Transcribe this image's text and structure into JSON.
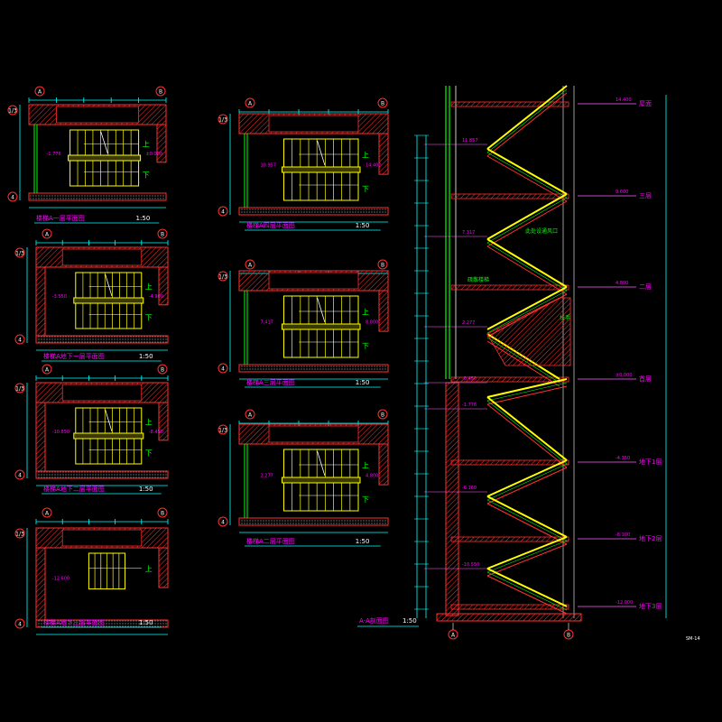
{
  "drawing": {
    "background": "#000000",
    "colors": {
      "wall": "#ff3030",
      "stair": "#ffff00",
      "dim": "#00ffff",
      "text": "#ff00ff",
      "green": "#00ff00",
      "white": "#ffffff",
      "level": "#ff60ff"
    },
    "sheet_code": "SM-14"
  },
  "plans": [
    {
      "id": "p1",
      "title": "楼梯A一层平面图",
      "scale": "1:50",
      "grid_left": "A",
      "grid_right": "B",
      "axis_top": "1/3",
      "axis_bottom": "4",
      "level_1": "-1.776",
      "level_2": "±0.000",
      "up": "上",
      "down": "下"
    },
    {
      "id": "p2",
      "title": "楼梯A地下一层平面图",
      "scale": "1:50",
      "grid_left": "A",
      "grid_right": "B",
      "axis_top": "1/3",
      "axis_bottom": "4",
      "level_1": "-3.550",
      "level_2": "-4.900",
      "up": "上",
      "down": "下"
    },
    {
      "id": "p3",
      "title": "楼梯A地下二层平面图",
      "scale": "1:50",
      "grid_left": "A",
      "grid_right": "B",
      "axis_top": "1/3",
      "axis_bottom": "4",
      "level_1": "-10.850",
      "level_2": "-8.450",
      "up": "上",
      "down": "下"
    },
    {
      "id": "p4",
      "title": "楼梯A地下三层平面图",
      "scale": "1:50",
      "grid_left": "A",
      "grid_right": "B",
      "axis_top": "1/3",
      "axis_bottom": "4",
      "level_1": "-12.600",
      "level_2": "",
      "up": "上",
      "down": ""
    },
    {
      "id": "p5",
      "title": "楼梯A四层平面图",
      "scale": "1:50",
      "grid_left": "A",
      "grid_right": "B",
      "axis_top": "1/3",
      "axis_bottom": "4",
      "level_1": "10.957",
      "level_2": "14.400",
      "up": "上",
      "down": "下"
    },
    {
      "id": "p6",
      "title": "楼梯A三层平面图",
      "scale": "1:50",
      "grid_left": "A",
      "grid_right": "B",
      "axis_top": "1/3",
      "axis_bottom": "4",
      "level_1": "7.417",
      "level_2": "8.800",
      "up": "上",
      "down": "下"
    },
    {
      "id": "p7",
      "title": "楼梯A二层平面图",
      "scale": "1:50",
      "grid_left": "A",
      "grid_right": "B",
      "axis_top": "1/3",
      "axis_bottom": "4",
      "level_1": "2.277",
      "level_2": "4.800",
      "up": "上",
      "down": "下"
    }
  ],
  "section": {
    "title": "A-A剖面图",
    "scale": "1:50",
    "grid_left": "A",
    "grid_right": "B",
    "levels": [
      {
        "name": "屋面",
        "value": "14.400"
      },
      {
        "name": "三层",
        "value": "9.600"
      },
      {
        "name": "二层",
        "value": "4.800"
      },
      {
        "name": "首层",
        "value": "±0.000"
      },
      {
        "name": "地下1层",
        "value": "-4.350"
      },
      {
        "name": "地下2层",
        "value": "-8.100"
      },
      {
        "name": "地下3层",
        "value": "-12.000"
      }
    ],
    "left_levels": [
      "11.857",
      "7.317",
      "2.277",
      "-0.450",
      "-1.776",
      "-6.160",
      "-10.550"
    ],
    "annotations": {
      "note_a": "此处设通风口",
      "note_b": "疏散楼梯",
      "note_c": "扶手"
    }
  }
}
